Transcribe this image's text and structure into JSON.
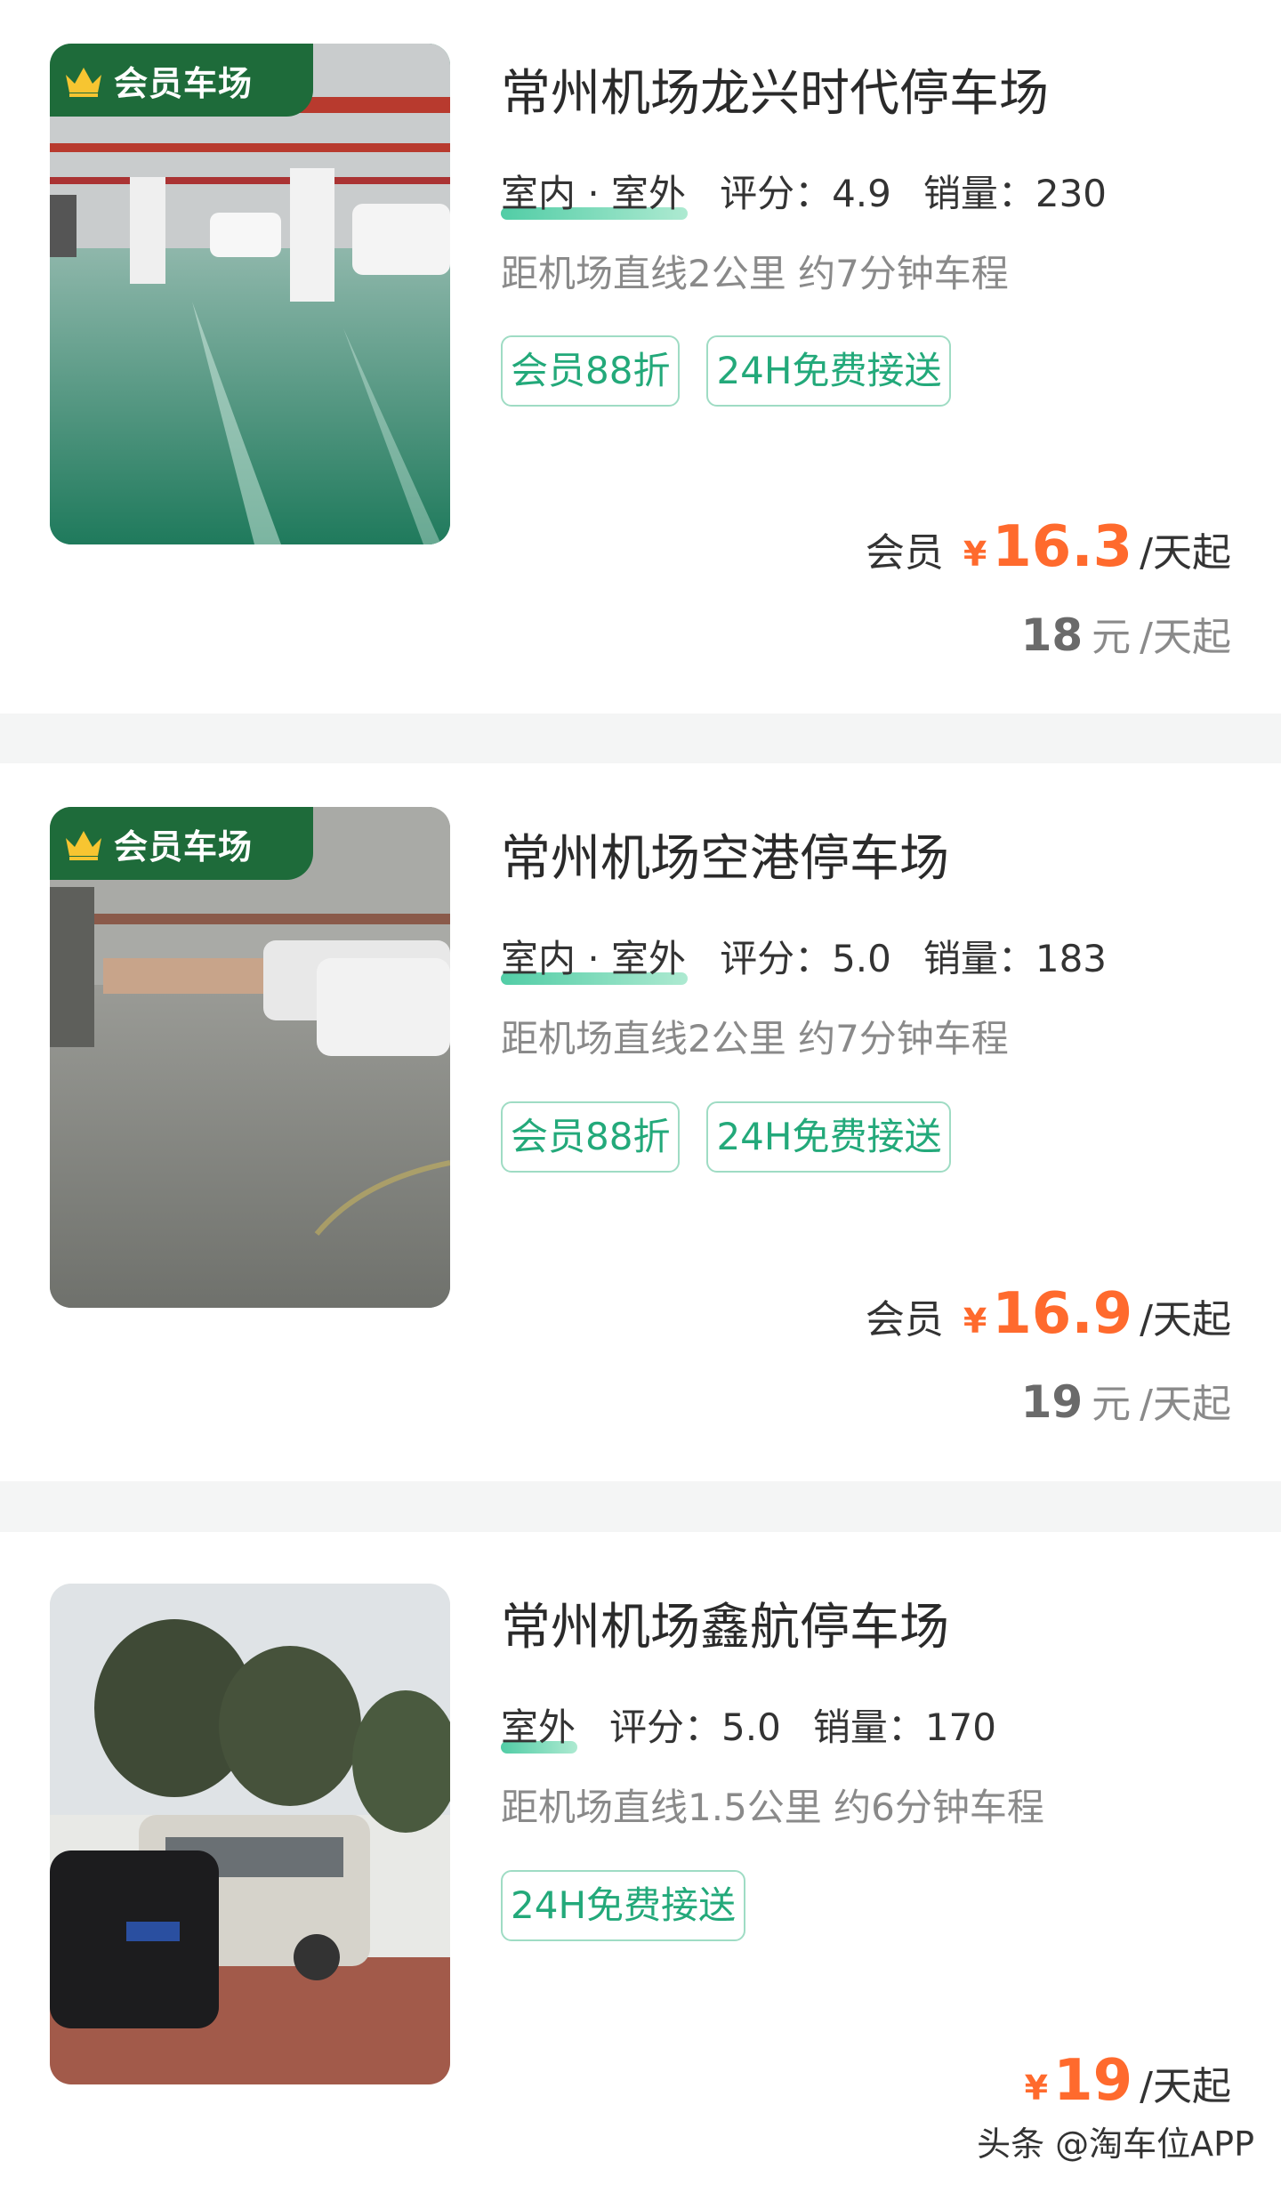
{
  "listings": [
    {
      "badge": "会员车场",
      "image_desc": "indoor-garage-green-floor",
      "name": "常州机场龙兴时代停车场",
      "type": "室内 · 室外",
      "rating": "评分：4.9",
      "sales": "销量：230",
      "distance": "距机场直线2公里 约7分钟车程",
      "tags": [
        "会员88折",
        "24H免费接送"
      ],
      "member_label": "会员",
      "currency": "¥",
      "price": "16.3",
      "price_unit": "/天起",
      "original_price": "18",
      "original_currency": "元",
      "original_unit": "/天起"
    },
    {
      "badge": "会员车场",
      "image_desc": "indoor-garage-concrete-floor",
      "name": "常州机场空港停车场",
      "type": "室内 · 室外",
      "rating": "评分：5.0",
      "sales": "销量：183",
      "distance": "距机场直线2公里 约7分钟车程",
      "tags": [
        "会员88折",
        "24H免费接送"
      ],
      "member_label": "会员",
      "currency": "¥",
      "price": "16.9",
      "price_unit": "/天起",
      "original_price": "19",
      "original_currency": "元",
      "original_unit": "/天起"
    },
    {
      "image_desc": "outdoor-lot-trees-cars",
      "name": "常州机场鑫航停车场",
      "type": "室外",
      "rating": "评分：5.0",
      "sales": "销量：170",
      "distance": "距机场直线1.5公里 约6分钟车程",
      "tags": [
        "24H免费接送"
      ],
      "currency": "¥",
      "price": "19",
      "price_unit": "/天起"
    }
  ],
  "watermark": "头条 @淘车位APP",
  "colors": {
    "accent_green": "#23a97a",
    "badge_green": "#1e6b3a",
    "price_orange": "#ff6a2d"
  }
}
